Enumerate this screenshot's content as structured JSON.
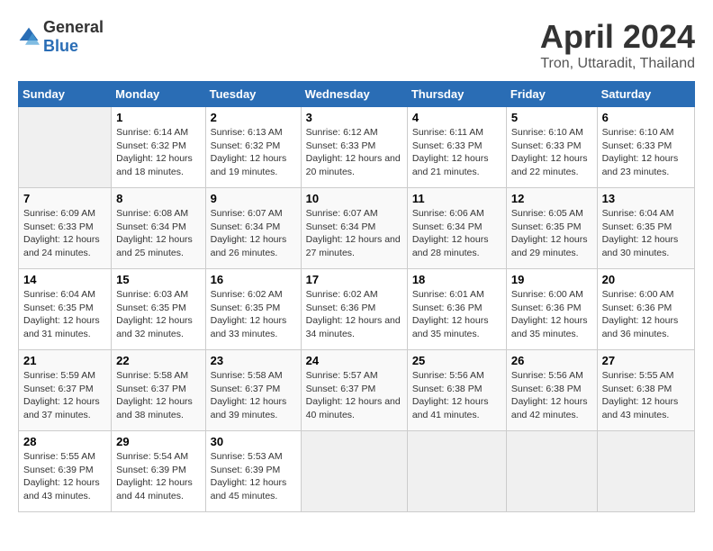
{
  "logo": {
    "general": "General",
    "blue": "Blue"
  },
  "title": "April 2024",
  "subtitle": "Tron, Uttaradit, Thailand",
  "days_header": [
    "Sunday",
    "Monday",
    "Tuesday",
    "Wednesday",
    "Thursday",
    "Friday",
    "Saturday"
  ],
  "weeks": [
    [
      {
        "day": "",
        "sunrise": "",
        "sunset": "",
        "daylight": ""
      },
      {
        "day": "1",
        "sunrise": "Sunrise: 6:14 AM",
        "sunset": "Sunset: 6:32 PM",
        "daylight": "Daylight: 12 hours and 18 minutes."
      },
      {
        "day": "2",
        "sunrise": "Sunrise: 6:13 AM",
        "sunset": "Sunset: 6:32 PM",
        "daylight": "Daylight: 12 hours and 19 minutes."
      },
      {
        "day": "3",
        "sunrise": "Sunrise: 6:12 AM",
        "sunset": "Sunset: 6:33 PM",
        "daylight": "Daylight: 12 hours and 20 minutes."
      },
      {
        "day": "4",
        "sunrise": "Sunrise: 6:11 AM",
        "sunset": "Sunset: 6:33 PM",
        "daylight": "Daylight: 12 hours and 21 minutes."
      },
      {
        "day": "5",
        "sunrise": "Sunrise: 6:10 AM",
        "sunset": "Sunset: 6:33 PM",
        "daylight": "Daylight: 12 hours and 22 minutes."
      },
      {
        "day": "6",
        "sunrise": "Sunrise: 6:10 AM",
        "sunset": "Sunset: 6:33 PM",
        "daylight": "Daylight: 12 hours and 23 minutes."
      }
    ],
    [
      {
        "day": "7",
        "sunrise": "Sunrise: 6:09 AM",
        "sunset": "Sunset: 6:33 PM",
        "daylight": "Daylight: 12 hours and 24 minutes."
      },
      {
        "day": "8",
        "sunrise": "Sunrise: 6:08 AM",
        "sunset": "Sunset: 6:34 PM",
        "daylight": "Daylight: 12 hours and 25 minutes."
      },
      {
        "day": "9",
        "sunrise": "Sunrise: 6:07 AM",
        "sunset": "Sunset: 6:34 PM",
        "daylight": "Daylight: 12 hours and 26 minutes."
      },
      {
        "day": "10",
        "sunrise": "Sunrise: 6:07 AM",
        "sunset": "Sunset: 6:34 PM",
        "daylight": "Daylight: 12 hours and 27 minutes."
      },
      {
        "day": "11",
        "sunrise": "Sunrise: 6:06 AM",
        "sunset": "Sunset: 6:34 PM",
        "daylight": "Daylight: 12 hours and 28 minutes."
      },
      {
        "day": "12",
        "sunrise": "Sunrise: 6:05 AM",
        "sunset": "Sunset: 6:35 PM",
        "daylight": "Daylight: 12 hours and 29 minutes."
      },
      {
        "day": "13",
        "sunrise": "Sunrise: 6:04 AM",
        "sunset": "Sunset: 6:35 PM",
        "daylight": "Daylight: 12 hours and 30 minutes."
      }
    ],
    [
      {
        "day": "14",
        "sunrise": "Sunrise: 6:04 AM",
        "sunset": "Sunset: 6:35 PM",
        "daylight": "Daylight: 12 hours and 31 minutes."
      },
      {
        "day": "15",
        "sunrise": "Sunrise: 6:03 AM",
        "sunset": "Sunset: 6:35 PM",
        "daylight": "Daylight: 12 hours and 32 minutes."
      },
      {
        "day": "16",
        "sunrise": "Sunrise: 6:02 AM",
        "sunset": "Sunset: 6:35 PM",
        "daylight": "Daylight: 12 hours and 33 minutes."
      },
      {
        "day": "17",
        "sunrise": "Sunrise: 6:02 AM",
        "sunset": "Sunset: 6:36 PM",
        "daylight": "Daylight: 12 hours and 34 minutes."
      },
      {
        "day": "18",
        "sunrise": "Sunrise: 6:01 AM",
        "sunset": "Sunset: 6:36 PM",
        "daylight": "Daylight: 12 hours and 35 minutes."
      },
      {
        "day": "19",
        "sunrise": "Sunrise: 6:00 AM",
        "sunset": "Sunset: 6:36 PM",
        "daylight": "Daylight: 12 hours and 35 minutes."
      },
      {
        "day": "20",
        "sunrise": "Sunrise: 6:00 AM",
        "sunset": "Sunset: 6:36 PM",
        "daylight": "Daylight: 12 hours and 36 minutes."
      }
    ],
    [
      {
        "day": "21",
        "sunrise": "Sunrise: 5:59 AM",
        "sunset": "Sunset: 6:37 PM",
        "daylight": "Daylight: 12 hours and 37 minutes."
      },
      {
        "day": "22",
        "sunrise": "Sunrise: 5:58 AM",
        "sunset": "Sunset: 6:37 PM",
        "daylight": "Daylight: 12 hours and 38 minutes."
      },
      {
        "day": "23",
        "sunrise": "Sunrise: 5:58 AM",
        "sunset": "Sunset: 6:37 PM",
        "daylight": "Daylight: 12 hours and 39 minutes."
      },
      {
        "day": "24",
        "sunrise": "Sunrise: 5:57 AM",
        "sunset": "Sunset: 6:37 PM",
        "daylight": "Daylight: 12 hours and 40 minutes."
      },
      {
        "day": "25",
        "sunrise": "Sunrise: 5:56 AM",
        "sunset": "Sunset: 6:38 PM",
        "daylight": "Daylight: 12 hours and 41 minutes."
      },
      {
        "day": "26",
        "sunrise": "Sunrise: 5:56 AM",
        "sunset": "Sunset: 6:38 PM",
        "daylight": "Daylight: 12 hours and 42 minutes."
      },
      {
        "day": "27",
        "sunrise": "Sunrise: 5:55 AM",
        "sunset": "Sunset: 6:38 PM",
        "daylight": "Daylight: 12 hours and 43 minutes."
      }
    ],
    [
      {
        "day": "28",
        "sunrise": "Sunrise: 5:55 AM",
        "sunset": "Sunset: 6:39 PM",
        "daylight": "Daylight: 12 hours and 43 minutes."
      },
      {
        "day": "29",
        "sunrise": "Sunrise: 5:54 AM",
        "sunset": "Sunset: 6:39 PM",
        "daylight": "Daylight: 12 hours and 44 minutes."
      },
      {
        "day": "30",
        "sunrise": "Sunrise: 5:53 AM",
        "sunset": "Sunset: 6:39 PM",
        "daylight": "Daylight: 12 hours and 45 minutes."
      },
      {
        "day": "",
        "sunrise": "",
        "sunset": "",
        "daylight": ""
      },
      {
        "day": "",
        "sunrise": "",
        "sunset": "",
        "daylight": ""
      },
      {
        "day": "",
        "sunrise": "",
        "sunset": "",
        "daylight": ""
      },
      {
        "day": "",
        "sunrise": "",
        "sunset": "",
        "daylight": ""
      }
    ]
  ]
}
